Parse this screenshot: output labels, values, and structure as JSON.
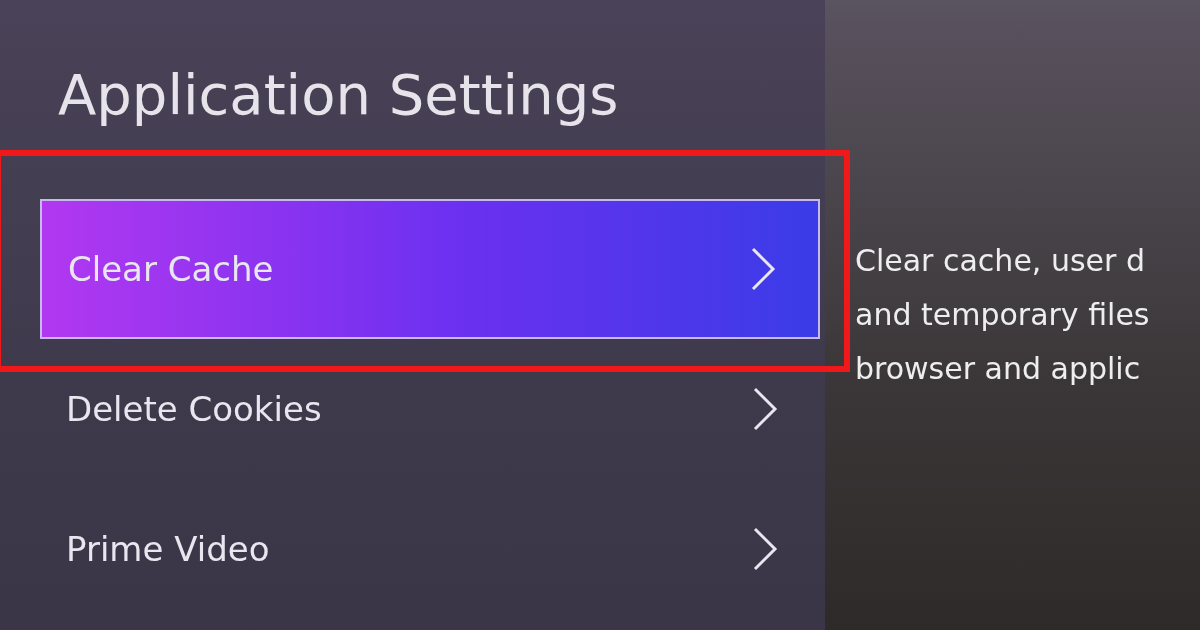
{
  "menu": {
    "title": "Application Settings",
    "items": [
      {
        "label": "Clear Cache",
        "selected": true
      },
      {
        "label": "Delete Cookies",
        "selected": false
      },
      {
        "label": "Prime Video",
        "selected": false
      }
    ]
  },
  "description": {
    "lines": [
      "Clear cache, user d",
      "and temporary files",
      "browser and applic"
    ]
  }
}
